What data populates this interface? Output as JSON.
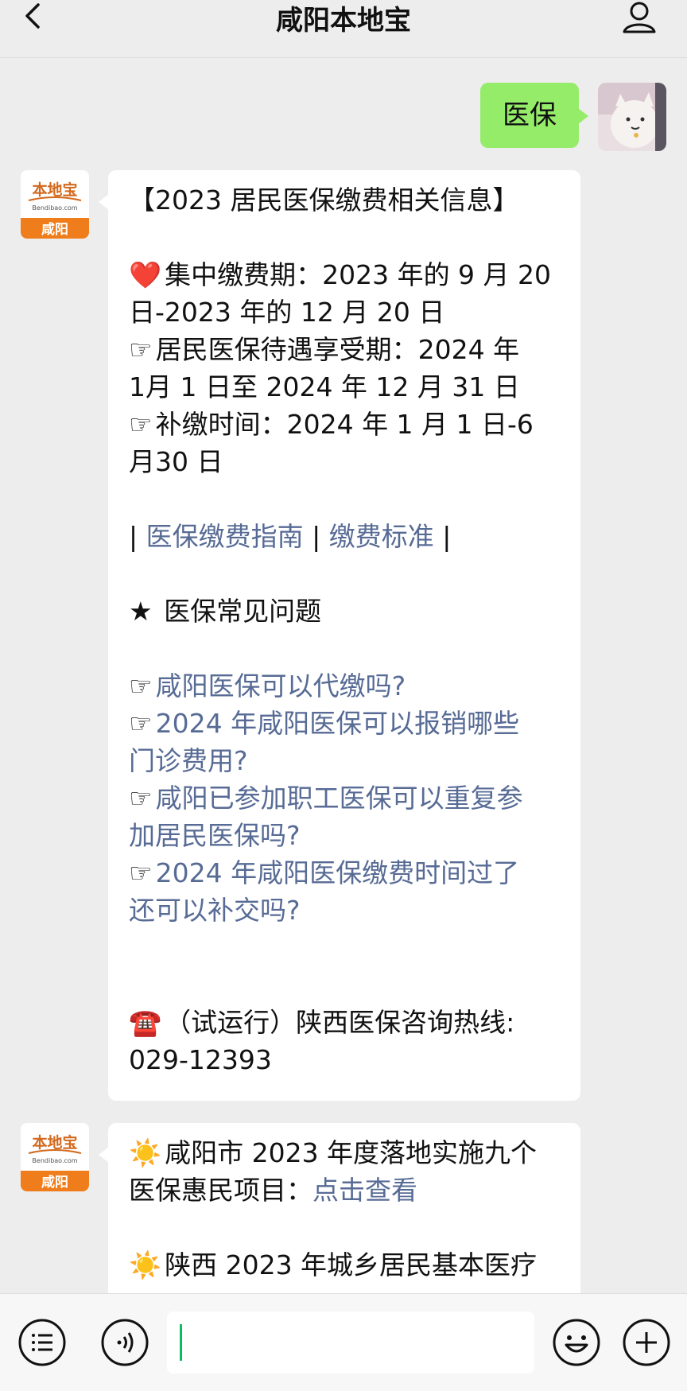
{
  "header": {
    "title": "咸阳本地宝"
  },
  "outgoing": {
    "text": "医保"
  },
  "logo": {
    "brand": "本地宝",
    "domain": "Bendibao.com",
    "city": "咸阳"
  },
  "message1": {
    "title": "【2023 居民医保缴费相关信息】",
    "p1_l1": "集中缴费期：2023 年的 9 月 20",
    "p1_l2": "日-2023 年的 12 月 20 日",
    "p2_l1": "居民医保待遇享受期：2024 年",
    "p2_l2": "1月 1 日至 2024 年 12 月 31 日",
    "p3_l1": "补缴时间：2024 年 1 月 1 日-6",
    "p3_l2": "月30 日",
    "link_guide": "医保缴费指南",
    "link_standard": "缴费标准",
    "faq_title": "医保常见问题",
    "faq1": "咸阳医保可以代缴吗?",
    "faq2_l1": "2024 年咸阳医保可以报销哪些",
    "faq2_l2": "门诊费用?",
    "faq3_l1": "咸阳已参加职工医保可以重复参",
    "faq3_l2": "加居民医保吗?",
    "faq4_l1": "2024 年咸阳医保缴费时间过了",
    "faq4_l2": "还可以补交吗?",
    "hotline_l1": "（试运行）陕西医保咨询热线:",
    "hotline_l2": "029-12393"
  },
  "message2": {
    "l1": "咸阳市 2023 年度落地实施九个",
    "l2_prefix": "医保惠民项目：",
    "l2_link": "点击查看",
    "l3": "陕西 2023 年城乡居民基本医疗"
  },
  "icons": {
    "bullet_heart": "❤️",
    "bullet_hand": "☞",
    "bullet_star": "★",
    "bullet_phone": "☎️",
    "bullet_sun": "☀️"
  },
  "colors": {
    "link": "#576b95",
    "outgoing_bubble": "#95ec69",
    "brand_orange": "#f07d1b"
  }
}
